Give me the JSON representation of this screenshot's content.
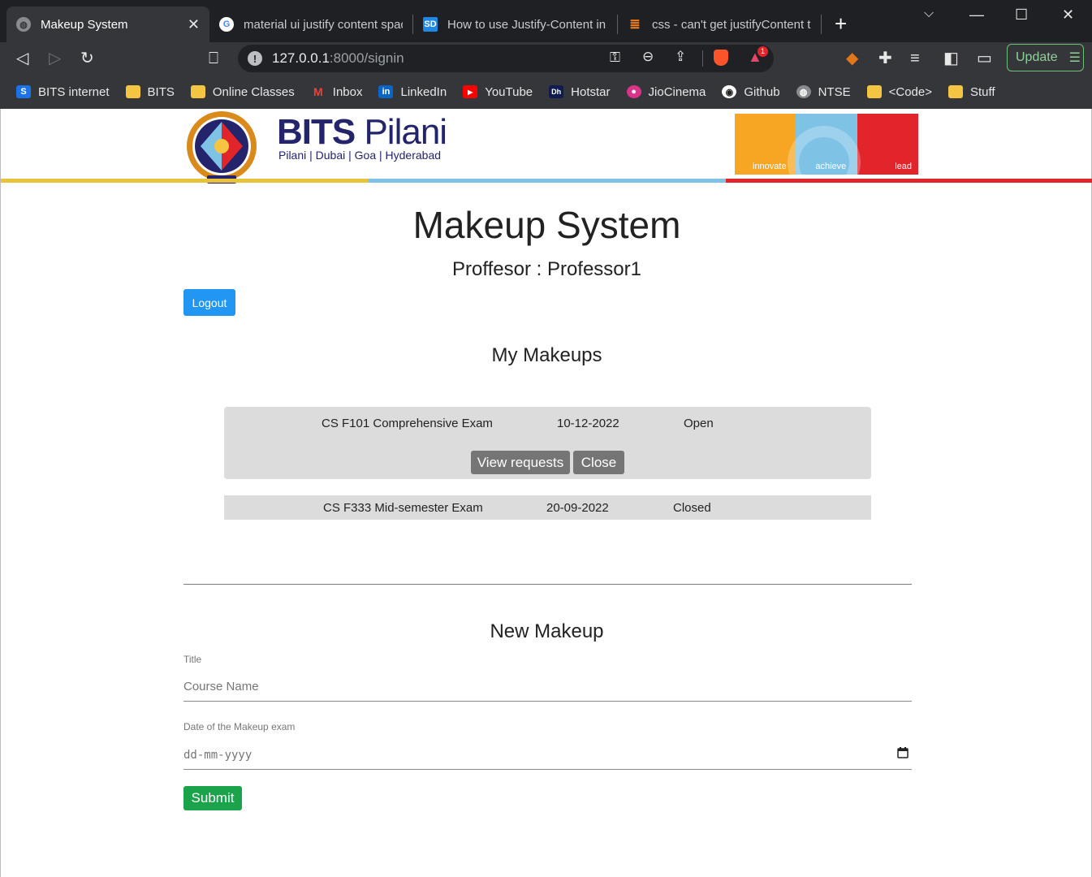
{
  "browser": {
    "tabs": [
      {
        "title": "Makeup System",
        "favicon": "globe-icon"
      },
      {
        "title": "material ui justify content space",
        "favicon": "google-icon"
      },
      {
        "title": "How to use Justify-Content in M",
        "favicon": "sd-icon",
        "favicon_text": "SD"
      },
      {
        "title": "css - can't get justifyContent to",
        "favicon": "stackoverflow-icon"
      }
    ],
    "url_host": "127.0.0.1",
    "url_path": ":8000/signin",
    "update_label": "Update",
    "bookmarks": [
      {
        "label": "BITS internet",
        "icon": "s-icon",
        "icon_text": "S",
        "color": "#1a73e8"
      },
      {
        "label": "BITS",
        "icon": "folder-icon"
      },
      {
        "label": "Online Classes",
        "icon": "folder-icon"
      },
      {
        "label": "Inbox",
        "icon": "gmail-icon",
        "icon_text": "M",
        "color": "#ea4335"
      },
      {
        "label": "LinkedIn",
        "icon": "linkedin-icon",
        "icon_text": "in",
        "color": "#0a66c2"
      },
      {
        "label": "YouTube",
        "icon": "youtube-icon",
        "icon_text": "▶",
        "color": "#ff0000"
      },
      {
        "label": "Hotstar",
        "icon": "hotstar-icon",
        "icon_text": "Dh",
        "color": "#0f1c4d"
      },
      {
        "label": "JioCinema",
        "icon": "jiocinema-icon",
        "icon_text": "●",
        "color": "#d9348a"
      },
      {
        "label": "Github",
        "icon": "github-icon",
        "icon_text": "◉",
        "color": "#444"
      },
      {
        "label": "NTSE",
        "icon": "globe-icon",
        "icon_text": "◍",
        "color": "#666"
      },
      {
        "label": "<Code>",
        "icon": "folder-icon"
      },
      {
        "label": "Stuff",
        "icon": "folder-icon"
      }
    ],
    "extension_badge": "1"
  },
  "header": {
    "brand_bold": "BITS",
    "brand_light": " Pilani",
    "campuses": "Pilani | Dubai | Goa | Hyderabad",
    "banner": [
      {
        "label": "innovate",
        "color": "#f6a623"
      },
      {
        "label": "achieve",
        "color": "#7ec3e6"
      },
      {
        "label": "lead",
        "color": "#e2242b"
      }
    ],
    "stripe_colors": [
      "#e8c33a",
      "#7ec3e6",
      "#e2242b"
    ]
  },
  "main": {
    "title": "Makeup System",
    "user_line": "Proffesor : Professor1",
    "logout_label": "Logout",
    "my_makeups_heading": "My Makeups",
    "makeups": [
      {
        "course": "CS F101 Comprehensive Exam",
        "date": "10-12-2022",
        "status": "Open",
        "actions": {
          "view": "View requests",
          "close": "Close"
        }
      },
      {
        "course": "CS F333 Mid-semester Exam",
        "date": "20-09-2022",
        "status": "Closed"
      }
    ],
    "new_makeup_heading": "New Makeup",
    "form": {
      "title_label": "Title",
      "title_placeholder": "Course Name",
      "date_label": "Date of the Makeup exam",
      "date_placeholder": "dd-mm-yyyy",
      "submit_label": "Submit"
    }
  }
}
